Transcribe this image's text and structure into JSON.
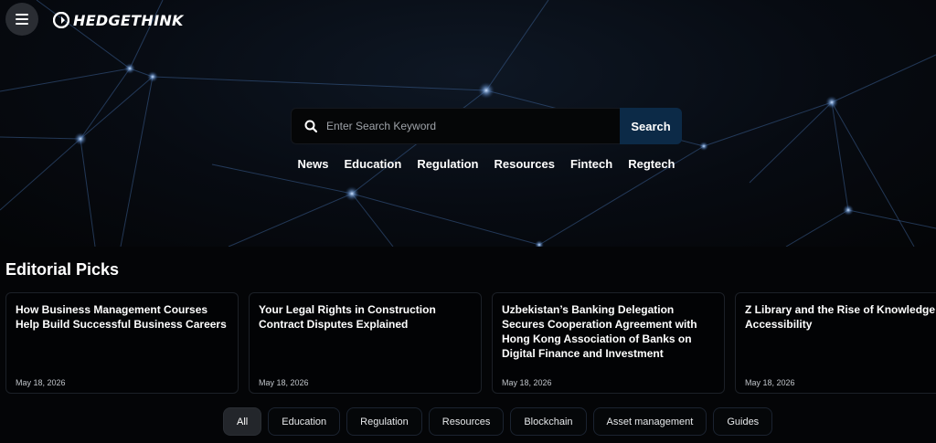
{
  "header": {
    "logo_text": "HEDGETHINK"
  },
  "search": {
    "placeholder": "Enter Search Keyword",
    "button_label": "Search"
  },
  "categories": [
    "News",
    "Education",
    "Regulation",
    "Resources",
    "Fintech",
    "Regtech"
  ],
  "editorial": {
    "title": "Editorial Picks",
    "cards": [
      {
        "title": "How Business Management Courses Help Build Successful Business Careers",
        "date": "May 18, 2026"
      },
      {
        "title": "Your Legal Rights in Construction Contract Disputes Explained",
        "date": "May 18, 2026"
      },
      {
        "title": "Uzbekistan’s Banking Delegation Secures Cooperation Agreement with Hong Kong Association of Banks on Digital Finance and Investment",
        "date": "May 18, 2026"
      },
      {
        "title": "Z Library and the Rise of Knowledge Accessibility",
        "date": "May 18, 2026"
      }
    ]
  },
  "filters": {
    "active": "All",
    "items": [
      "All",
      "Education",
      "Regulation",
      "Resources",
      "Blockchain",
      "Asset management",
      "Guides"
    ]
  },
  "icons": {
    "menu": "hamburger-menu-icon",
    "logo": "hedgethink-logo-icon",
    "search": "search-icon"
  },
  "colors": {
    "background": "#040507",
    "search_button": "#0c2a47",
    "active_pill": "#23262b"
  }
}
